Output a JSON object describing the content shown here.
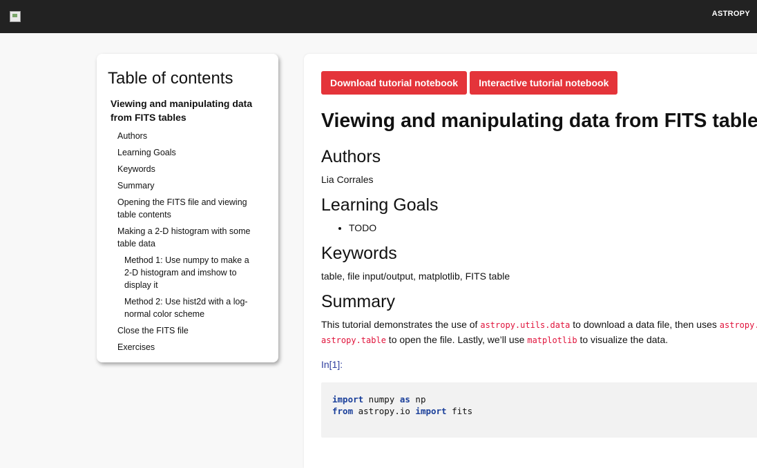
{
  "header": {
    "brand": "ASTROPY"
  },
  "toc": {
    "title": "Table of contents",
    "items": [
      {
        "label": "Viewing and manipulating data from FITS tables",
        "level": 1
      },
      {
        "label": "Authors",
        "level": 2
      },
      {
        "label": "Learning Goals",
        "level": 2
      },
      {
        "label": "Keywords",
        "level": 2
      },
      {
        "label": "Summary",
        "level": 2
      },
      {
        "label": "Opening the FITS file and viewing table contents",
        "level": 2
      },
      {
        "label": "Making a 2-D histogram with some table data",
        "level": 2
      },
      {
        "label": "Method 1: Use numpy to make a 2-D histogram and imshow to display it",
        "level": 3
      },
      {
        "label": "Method 2: Use hist2d with a log-normal color scheme",
        "level": 3
      },
      {
        "label": "Close the FITS file",
        "level": 2
      },
      {
        "label": "Exercises",
        "level": 2
      }
    ]
  },
  "buttons": {
    "download": "Download tutorial notebook",
    "interactive": "Interactive tutorial notebook"
  },
  "article": {
    "title": "Viewing and manipulating data from FITS tables",
    "authors_heading": "Authors",
    "authors_text": "Lia Corrales",
    "goals_heading": "Learning Goals",
    "goals": [
      "TODO"
    ],
    "keywords_heading": "Keywords",
    "keywords_text": "table, file input/output, matplotlib, FITS table",
    "summary_heading": "Summary",
    "summary": {
      "line1_a": "This tutorial demonstrates the use of ",
      "line1_code1": "astropy.utils.data",
      "line1_b": " to download a data file, then uses ",
      "line1_code2": "astropy.io.fits",
      "line2_code": "astropy.table",
      "line2_a": " to open the file. Lastly, we’ll use ",
      "line2_code2": "matplotlib",
      "line2_b": " to visualize the data."
    },
    "prompt": "In[1]:",
    "code": [
      {
        "kw1": "import",
        "t1": " numpy ",
        "kw2": "as",
        "t2": " np"
      },
      {
        "kw1": "from",
        "t1": " astropy.io ",
        "kw2": "import",
        "t2": " fits"
      }
    ]
  },
  "colors": {
    "topbar": "#222222",
    "button": "#e4343a",
    "inline_code": "#e0123a",
    "prompt": "#303f9f",
    "keyword": "#1a3f9a"
  }
}
